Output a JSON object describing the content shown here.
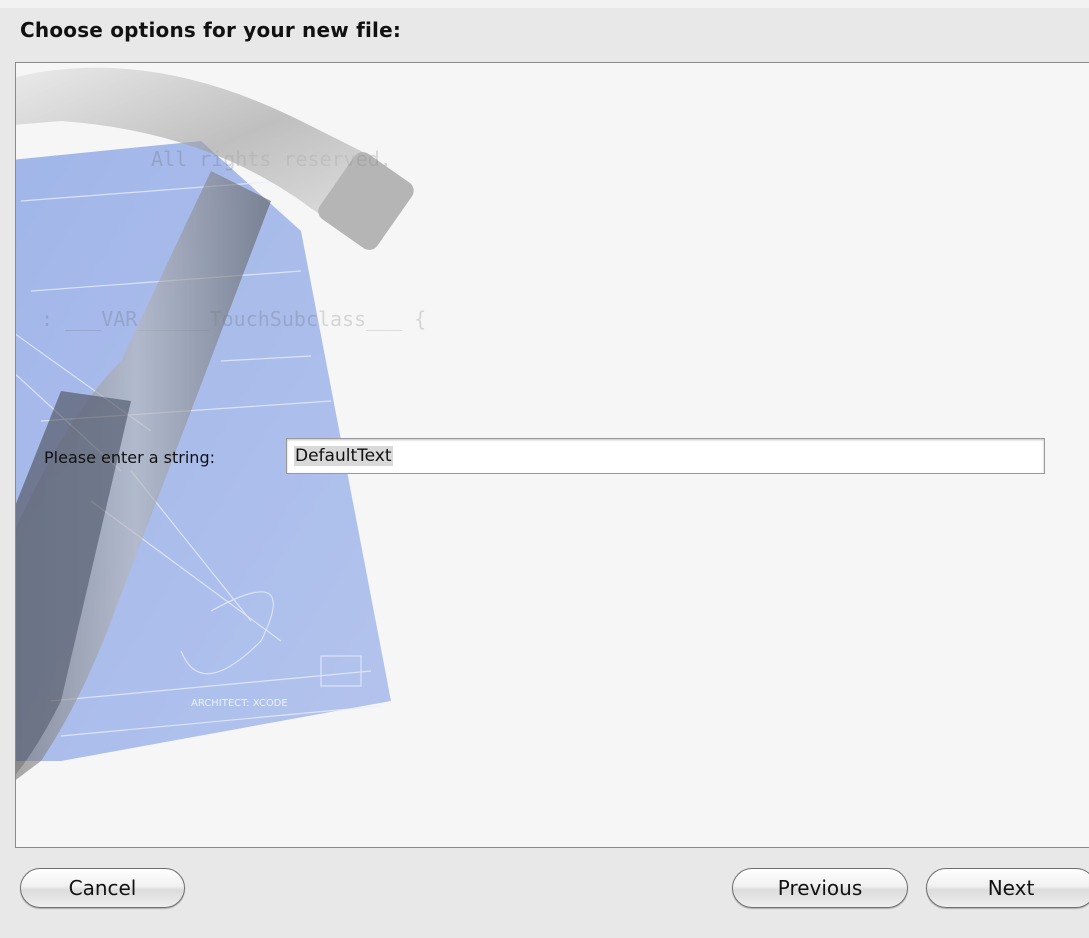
{
  "dialog": {
    "title": "Choose options for your new file:"
  },
  "form": {
    "string_label": "Please enter a string:",
    "string_value": "DefaultText"
  },
  "background": {
    "blueprint_label": "ARCHITECT: XCODE",
    "code_line_1": "All rights reserved.",
    "code_line_2": ": ___VAR______TouchSubclass___ {"
  },
  "buttons": {
    "cancel": "Cancel",
    "previous": "Previous",
    "next": "Next"
  },
  "colors": {
    "blueprint": "#6f8fe0",
    "window_bg": "#e8e8e8",
    "panel_bg": "#f6f6f6"
  }
}
